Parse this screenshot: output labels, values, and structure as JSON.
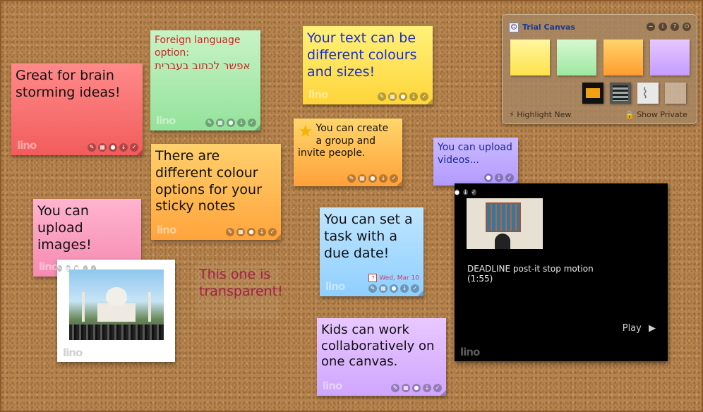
{
  "board": {
    "notes": {
      "brain": "Great for brain\nstorming ideas!",
      "foreign_1": "Foreign language\noption:",
      "foreign_2": "אפשר לכתוב בעברית",
      "colours_text": "Your text can be\ndifferent colours\nand sizes!",
      "group": "You can create\na group and\ninvite people.",
      "colour_options": "There are\ndifferent colour\noptions for your\nsticky notes",
      "videos": "You can upload\nvideos...",
      "images": "You can upload\nimages!",
      "transparent": "This one is\ntransparent!",
      "task": "You can set a\ntask with a\ndue date!",
      "due_date": "Wed, Mar 10",
      "kids": "Kids can work\ncollaboratively on\none canvas."
    },
    "logo": "lino",
    "video": {
      "title": "DEADLINE post-it stop motion\n(1:55)",
      "play_label": "Play"
    }
  },
  "panel": {
    "title": "Trial Canvas",
    "highlight_label": "Highlight New",
    "show_private_label": "Show Private"
  }
}
